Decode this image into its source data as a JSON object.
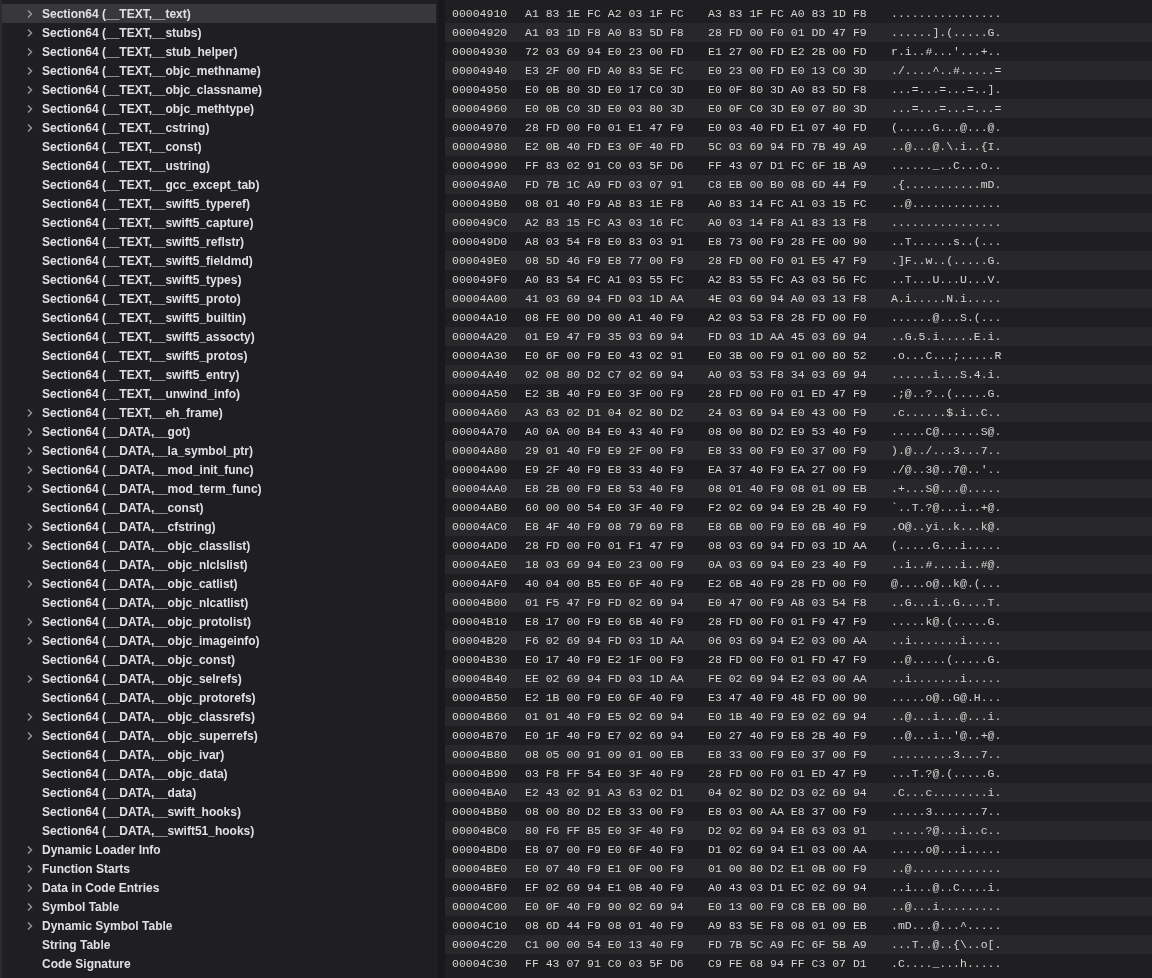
{
  "outline": {
    "items": [
      {
        "label": "Section64 (__TEXT,__text)",
        "expandable": true,
        "selected": true
      },
      {
        "label": "Section64 (__TEXT,__stubs)",
        "expandable": true,
        "selected": false
      },
      {
        "label": "Section64 (__TEXT,__stub_helper)",
        "expandable": true,
        "selected": false
      },
      {
        "label": "Section64 (__TEXT,__objc_methname)",
        "expandable": true,
        "selected": false
      },
      {
        "label": "Section64 (__TEXT,__objc_classname)",
        "expandable": true,
        "selected": false
      },
      {
        "label": "Section64 (__TEXT,__objc_methtype)",
        "expandable": true,
        "selected": false
      },
      {
        "label": "Section64 (__TEXT,__cstring)",
        "expandable": true,
        "selected": false
      },
      {
        "label": "Section64 (__TEXT,__const)",
        "expandable": false,
        "selected": false
      },
      {
        "label": "Section64 (__TEXT,__ustring)",
        "expandable": false,
        "selected": false
      },
      {
        "label": "Section64 (__TEXT,__gcc_except_tab)",
        "expandable": false,
        "selected": false
      },
      {
        "label": "Section64 (__TEXT,__swift5_typeref)",
        "expandable": false,
        "selected": false
      },
      {
        "label": "Section64 (__TEXT,__swift5_capture)",
        "expandable": false,
        "selected": false
      },
      {
        "label": "Section64 (__TEXT,__swift5_reflstr)",
        "expandable": false,
        "selected": false
      },
      {
        "label": "Section64 (__TEXT,__swift5_fieldmd)",
        "expandable": false,
        "selected": false
      },
      {
        "label": "Section64 (__TEXT,__swift5_types)",
        "expandable": false,
        "selected": false
      },
      {
        "label": "Section64 (__TEXT,__swift5_proto)",
        "expandable": false,
        "selected": false
      },
      {
        "label": "Section64 (__TEXT,__swift5_builtin)",
        "expandable": false,
        "selected": false
      },
      {
        "label": "Section64 (__TEXT,__swift5_assocty)",
        "expandable": false,
        "selected": false
      },
      {
        "label": "Section64 (__TEXT,__swift5_protos)",
        "expandable": false,
        "selected": false
      },
      {
        "label": "Section64 (__TEXT,__swift5_entry)",
        "expandable": false,
        "selected": false
      },
      {
        "label": "Section64 (__TEXT,__unwind_info)",
        "expandable": false,
        "selected": false
      },
      {
        "label": "Section64 (__TEXT,__eh_frame)",
        "expandable": true,
        "selected": false
      },
      {
        "label": "Section64 (__DATA,__got)",
        "expandable": true,
        "selected": false
      },
      {
        "label": "Section64 (__DATA,__la_symbol_ptr)",
        "expandable": true,
        "selected": false
      },
      {
        "label": "Section64 (__DATA,__mod_init_func)",
        "expandable": true,
        "selected": false
      },
      {
        "label": "Section64 (__DATA,__mod_term_func)",
        "expandable": true,
        "selected": false
      },
      {
        "label": "Section64 (__DATA,__const)",
        "expandable": false,
        "selected": false
      },
      {
        "label": "Section64 (__DATA,__cfstring)",
        "expandable": true,
        "selected": false
      },
      {
        "label": "Section64 (__DATA,__objc_classlist)",
        "expandable": true,
        "selected": false
      },
      {
        "label": "Section64 (__DATA,__objc_nlclslist)",
        "expandable": false,
        "selected": false
      },
      {
        "label": "Section64 (__DATA,__objc_catlist)",
        "expandable": true,
        "selected": false
      },
      {
        "label": "Section64 (__DATA,__objc_nlcatlist)",
        "expandable": false,
        "selected": false
      },
      {
        "label": "Section64 (__DATA,__objc_protolist)",
        "expandable": true,
        "selected": false
      },
      {
        "label": "Section64 (__DATA,__objc_imageinfo)",
        "expandable": true,
        "selected": false
      },
      {
        "label": "Section64 (__DATA,__objc_const)",
        "expandable": false,
        "selected": false
      },
      {
        "label": "Section64 (__DATA,__objc_selrefs)",
        "expandable": true,
        "selected": false
      },
      {
        "label": "Section64 (__DATA,__objc_protorefs)",
        "expandable": false,
        "selected": false
      },
      {
        "label": "Section64 (__DATA,__objc_classrefs)",
        "expandable": true,
        "selected": false
      },
      {
        "label": "Section64 (__DATA,__objc_superrefs)",
        "expandable": true,
        "selected": false
      },
      {
        "label": "Section64 (__DATA,__objc_ivar)",
        "expandable": false,
        "selected": false
      },
      {
        "label": "Section64 (__DATA,__objc_data)",
        "expandable": false,
        "selected": false
      },
      {
        "label": "Section64 (__DATA,__data)",
        "expandable": false,
        "selected": false
      },
      {
        "label": "Section64 (__DATA,__swift_hooks)",
        "expandable": false,
        "selected": false
      },
      {
        "label": "Section64 (__DATA,__swift51_hooks)",
        "expandable": false,
        "selected": false
      },
      {
        "label": "Dynamic Loader Info",
        "expandable": true,
        "selected": false
      },
      {
        "label": "Function Starts",
        "expandable": true,
        "selected": false
      },
      {
        "label": "Data in Code Entries",
        "expandable": true,
        "selected": false
      },
      {
        "label": "Symbol Table",
        "expandable": true,
        "selected": false
      },
      {
        "label": "Dynamic Symbol Table",
        "expandable": true,
        "selected": false
      },
      {
        "label": "String Table",
        "expandable": false,
        "selected": false
      },
      {
        "label": "Code Signature",
        "expandable": false,
        "selected": false
      }
    ]
  },
  "hex_view": {
    "rows": [
      {
        "address": "00004910",
        "bytes": [
          "A1 83 1E FC A2 03 1F FC",
          "A3 83 1F FC A0 83 1D F8"
        ],
        "ascii": "................"
      },
      {
        "address": "00004920",
        "bytes": [
          "A1 03 1D F8 A0 83 5D F8",
          "28 FD 00 F0 01 DD 47 F9"
        ],
        "ascii": "......].(.....G."
      },
      {
        "address": "00004930",
        "bytes": [
          "72 03 69 94 E0 23 00 FD",
          "E1 27 00 FD E2 2B 00 FD"
        ],
        "ascii": "r.i..#...'...+.."
      },
      {
        "address": "00004940",
        "bytes": [
          "E3 2F 00 FD A0 83 5E FC",
          "E0 23 00 FD E0 13 C0 3D"
        ],
        "ascii": "./....^..#.....="
      },
      {
        "address": "00004950",
        "bytes": [
          "E0 0B 80 3D E0 17 C0 3D",
          "E0 0F 80 3D A0 83 5D F8"
        ],
        "ascii": "...=...=...=..]."
      },
      {
        "address": "00004960",
        "bytes": [
          "E0 0B C0 3D E0 03 80 3D",
          "E0 0F C0 3D E0 07 80 3D"
        ],
        "ascii": "...=...=...=...="
      },
      {
        "address": "00004970",
        "bytes": [
          "28 FD 00 F0 01 E1 47 F9",
          "E0 03 40 FD E1 07 40 FD"
        ],
        "ascii": "(.....G...@...@."
      },
      {
        "address": "00004980",
        "bytes": [
          "E2 0B 40 FD E3 0F 40 FD",
          "5C 03 69 94 FD 7B 49 A9"
        ],
        "ascii": "..@...@.\\.i..{I."
      },
      {
        "address": "00004990",
        "bytes": [
          "FF 83 02 91 C0 03 5F D6",
          "FF 43 07 D1 FC 6F 1B A9"
        ],
        "ascii": "......_..C...o.."
      },
      {
        "address": "000049A0",
        "bytes": [
          "FD 7B 1C A9 FD 03 07 91",
          "C8 EB 00 B0 08 6D 44 F9"
        ],
        "ascii": ".{...........mD."
      },
      {
        "address": "000049B0",
        "bytes": [
          "08 01 40 F9 A8 83 1E F8",
          "A0 83 14 FC A1 03 15 FC"
        ],
        "ascii": "..@............."
      },
      {
        "address": "000049C0",
        "bytes": [
          "A2 83 15 FC A3 03 16 FC",
          "A0 03 14 F8 A1 83 13 F8"
        ],
        "ascii": "................"
      },
      {
        "address": "000049D0",
        "bytes": [
          "A8 03 54 F8 E0 83 03 91",
          "E8 73 00 F9 28 FE 00 90"
        ],
        "ascii": "..T......s..(..."
      },
      {
        "address": "000049E0",
        "bytes": [
          "08 5D 46 F9 E8 77 00 F9",
          "28 FD 00 F0 01 E5 47 F9"
        ],
        "ascii": ".]F..w..(.....G."
      },
      {
        "address": "000049F0",
        "bytes": [
          "A0 83 54 FC A1 03 55 FC",
          "A2 83 55 FC A3 03 56 FC"
        ],
        "ascii": "..T...U...U...V."
      },
      {
        "address": "00004A00",
        "bytes": [
          "41 03 69 94 FD 03 1D AA",
          "4E 03 69 94 A0 03 13 F8"
        ],
        "ascii": "A.i.....N.i....."
      },
      {
        "address": "00004A10",
        "bytes": [
          "08 FE 00 D0 00 A1 40 F9",
          "A2 03 53 F8 28 FD 00 F0"
        ],
        "ascii": "......@...S.(..."
      },
      {
        "address": "00004A20",
        "bytes": [
          "01 E9 47 F9 35 03 69 94",
          "FD 03 1D AA 45 03 69 94"
        ],
        "ascii": "..G.5.i.....E.i."
      },
      {
        "address": "00004A30",
        "bytes": [
          "E0 6F 00 F9 E0 43 02 91",
          "E0 3B 00 F9 01 00 80 52"
        ],
        "ascii": ".o...C...;.....R"
      },
      {
        "address": "00004A40",
        "bytes": [
          "02 08 80 D2 C7 02 69 94",
          "A0 03 53 F8 34 03 69 94"
        ],
        "ascii": "......i...S.4.i."
      },
      {
        "address": "00004A50",
        "bytes": [
          "E2 3B 40 F9 E0 3F 00 F9",
          "28 FD 00 F0 01 ED 47 F9"
        ],
        "ascii": ".;@..?..(.....G."
      },
      {
        "address": "00004A60",
        "bytes": [
          "A3 63 02 D1 04 02 80 D2",
          "24 03 69 94 E0 43 00 F9"
        ],
        "ascii": ".c......$.i..C.."
      },
      {
        "address": "00004A70",
        "bytes": [
          "A0 0A 00 B4 E0 43 40 F9",
          "08 00 80 D2 E9 53 40 F9"
        ],
        "ascii": ".....C@......S@."
      },
      {
        "address": "00004A80",
        "bytes": [
          "29 01 40 F9 E9 2F 00 F9",
          "E8 33 00 F9 E0 37 00 F9"
        ],
        "ascii": ").@../...3...7.."
      },
      {
        "address": "00004A90",
        "bytes": [
          "E9 2F 40 F9 E8 33 40 F9",
          "EA 37 40 F9 EA 27 00 F9"
        ],
        "ascii": "./@..3@..7@..'.."
      },
      {
        "address": "00004AA0",
        "bytes": [
          "E8 2B 00 F9 E8 53 40 F9",
          "08 01 40 F9 08 01 09 EB"
        ],
        "ascii": ".+...S@...@....."
      },
      {
        "address": "00004AB0",
        "bytes": [
          "60 00 00 54 E0 3F 40 F9",
          "F2 02 69 94 E9 2B 40 F9"
        ],
        "ascii": "`..T.?@...i..+@."
      },
      {
        "address": "00004AC0",
        "bytes": [
          "E8 4F 40 F9 08 79 69 F8",
          "E8 6B 00 F9 E0 6B 40 F9"
        ],
        "ascii": ".O@..yi..k...k@."
      },
      {
        "address": "00004AD0",
        "bytes": [
          "28 FD 00 F0 01 F1 47 F9",
          "08 03 69 94 FD 03 1D AA"
        ],
        "ascii": "(.....G...i....."
      },
      {
        "address": "00004AE0",
        "bytes": [
          "18 03 69 94 E0 23 00 F9",
          "0A 03 69 94 E0 23 40 F9"
        ],
        "ascii": "..i..#....i..#@."
      },
      {
        "address": "00004AF0",
        "bytes": [
          "40 04 00 B5 E0 6F 40 F9",
          "E2 6B 40 F9 28 FD 00 F0"
        ],
        "ascii": "@....o@..k@.(..."
      },
      {
        "address": "00004B00",
        "bytes": [
          "01 F5 47 F9 FD 02 69 94",
          "E0 47 00 F9 A8 03 54 F8"
        ],
        "ascii": "..G...i..G....T."
      },
      {
        "address": "00004B10",
        "bytes": [
          "E8 17 00 F9 E0 6B 40 F9",
          "28 FD 00 F0 01 F9 47 F9"
        ],
        "ascii": ".....k@.(.....G."
      },
      {
        "address": "00004B20",
        "bytes": [
          "F6 02 69 94 FD 03 1D AA",
          "06 03 69 94 E2 03 00 AA"
        ],
        "ascii": "..i.......i....."
      },
      {
        "address": "00004B30",
        "bytes": [
          "E0 17 40 F9 E2 1F 00 F9",
          "28 FD 00 F0 01 FD 47 F9"
        ],
        "ascii": "..@.....(.....G."
      },
      {
        "address": "00004B40",
        "bytes": [
          "EE 02 69 94 FD 03 1D AA",
          "FE 02 69 94 E2 03 00 AA"
        ],
        "ascii": "..i.......i....."
      },
      {
        "address": "00004B50",
        "bytes": [
          "E2 1B 00 F9 E0 6F 40 F9",
          "E3 47 40 F9 48 FD 00 90"
        ],
        "ascii": ".....o@..G@.H..."
      },
      {
        "address": "00004B60",
        "bytes": [
          "01 01 40 F9 E5 02 69 94",
          "E0 1B 40 F9 E9 02 69 94"
        ],
        "ascii": "..@...i...@...i."
      },
      {
        "address": "00004B70",
        "bytes": [
          "E0 1F 40 F9 E7 02 69 94",
          "E0 27 40 F9 E8 2B 40 F9"
        ],
        "ascii": "..@...i..'@..+@."
      },
      {
        "address": "00004B80",
        "bytes": [
          "08 05 00 91 09 01 00 EB",
          "E8 33 00 F9 E0 37 00 F9"
        ],
        "ascii": ".........3...7.."
      },
      {
        "address": "00004B90",
        "bytes": [
          "03 F8 FF 54 E0 3F 40 F9",
          "28 FD 00 F0 01 ED 47 F9"
        ],
        "ascii": "...T.?@.(.....G."
      },
      {
        "address": "00004BA0",
        "bytes": [
          "E2 43 02 91 A3 63 02 D1",
          "04 02 80 D2 D3 02 69 94"
        ],
        "ascii": ".C...c........i."
      },
      {
        "address": "00004BB0",
        "bytes": [
          "08 00 80 D2 E8 33 00 F9",
          "E8 03 00 AA E8 37 00 F9"
        ],
        "ascii": ".....3.......7.."
      },
      {
        "address": "00004BC0",
        "bytes": [
          "80 F6 FF B5 E0 3F 40 F9",
          "D2 02 69 94 E8 63 03 91"
        ],
        "ascii": ".....?@...i..c.."
      },
      {
        "address": "00004BD0",
        "bytes": [
          "E8 07 00 F9 E0 6F 40 F9",
          "D1 02 69 94 E1 03 00 AA"
        ],
        "ascii": ".....o@...i....."
      },
      {
        "address": "00004BE0",
        "bytes": [
          "E0 07 40 F9 E1 0F 00 F9",
          "01 00 80 D2 E1 0B 00 F9"
        ],
        "ascii": "..@............."
      },
      {
        "address": "00004BF0",
        "bytes": [
          "EF 02 69 94 E1 0B 40 F9",
          "A0 43 03 D1 EC 02 69 94"
        ],
        "ascii": "..i...@..C....i."
      },
      {
        "address": "00004C00",
        "bytes": [
          "E0 0F 40 F9 90 02 69 94",
          "E0 13 00 F9 C8 EB 00 B0"
        ],
        "ascii": "..@...i........."
      },
      {
        "address": "00004C10",
        "bytes": [
          "08 6D 44 F9 08 01 40 F9",
          "A9 83 5E F8 08 01 09 EB"
        ],
        "ascii": ".mD...@...^....."
      },
      {
        "address": "00004C20",
        "bytes": [
          "C1 00 00 54 E0 13 40 F9",
          "FD 7B 5C A9 FC 6F 5B A9"
        ],
        "ascii": "...T..@..{\\..o[."
      },
      {
        "address": "00004C30",
        "bytes": [
          "FF 43 07 91 C0 03 5F D6",
          "C9 FE 68 94 FF C3 07 D1"
        ],
        "ascii": ".C...._...h....."
      }
    ]
  }
}
